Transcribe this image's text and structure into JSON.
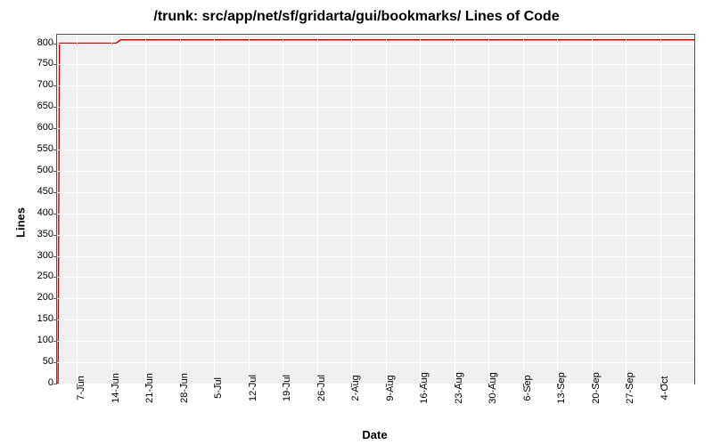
{
  "chart_data": {
    "type": "line",
    "title": "/trunk: src/app/net/sf/gridarta/gui/bookmarks/ Lines of Code",
    "xlabel": "Date",
    "ylabel": "Lines",
    "ylim": [
      0,
      800
    ],
    "yticks": [
      0,
      50,
      100,
      150,
      200,
      250,
      300,
      350,
      400,
      450,
      500,
      550,
      600,
      650,
      700,
      750,
      800
    ],
    "xticks": [
      "7-Jun",
      "14-Jun",
      "21-Jun",
      "28-Jun",
      "5-Jul",
      "12-Jul",
      "19-Jul",
      "26-Jul",
      "2-Aug",
      "9-Aug",
      "16-Aug",
      "23-Aug",
      "30-Aug",
      "6-Sep",
      "13-Sep",
      "20-Sep",
      "27-Sep",
      "4-Oct"
    ],
    "x_domain_days": 130,
    "x_start_offset_days": 4,
    "series": [
      {
        "name": "lines-of-code",
        "points": [
          {
            "day": 0,
            "value": 0
          },
          {
            "day": 0.2,
            "value": 0
          },
          {
            "day": 0.5,
            "value": 800
          },
          {
            "day": 12,
            "value": 800
          },
          {
            "day": 13,
            "value": 808
          },
          {
            "day": 130,
            "value": 808
          }
        ]
      }
    ]
  }
}
